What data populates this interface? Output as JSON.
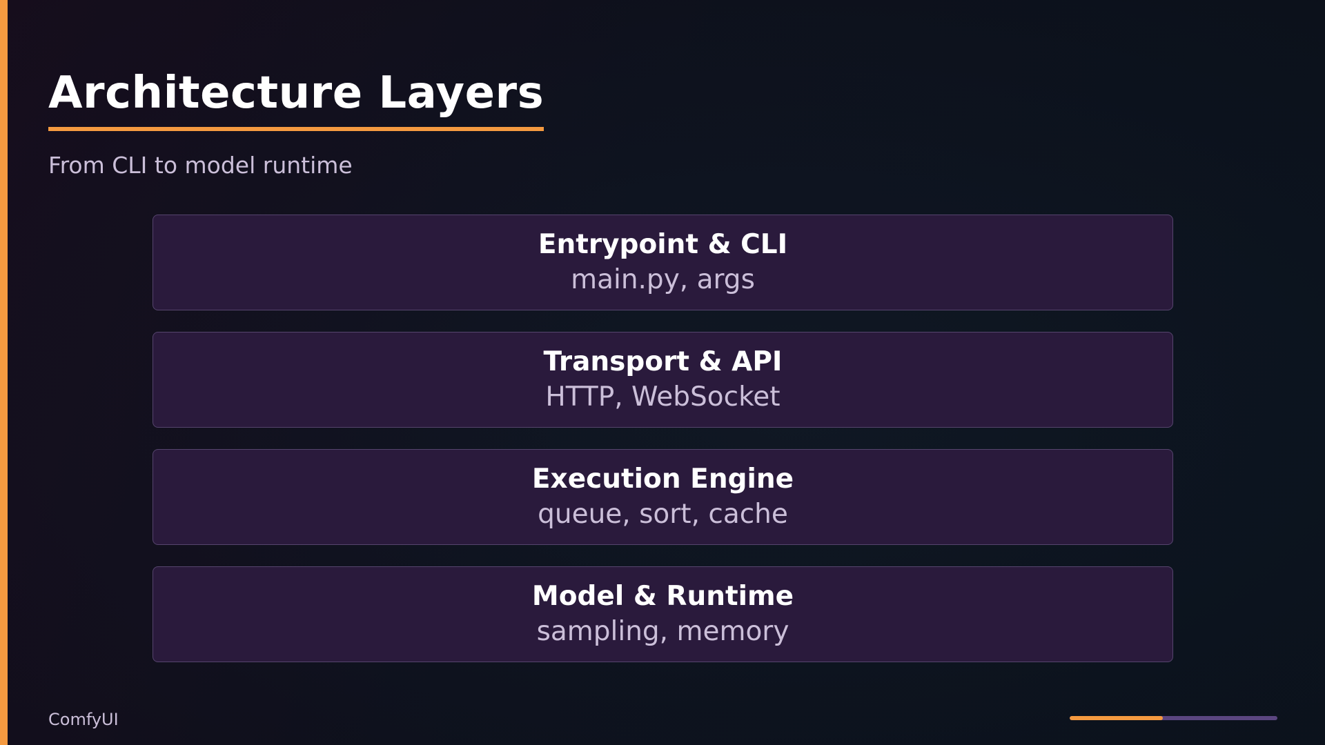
{
  "slide": {
    "title": "Architecture Layers",
    "subtitle": "From CLI to model runtime",
    "brand": "ComfyUI"
  },
  "layers": [
    {
      "title": "Entrypoint & CLI",
      "detail": "main.py, args"
    },
    {
      "title": "Transport & API",
      "detail": "HTTP, WebSocket"
    },
    {
      "title": "Execution Engine",
      "detail": "queue, sort, cache"
    },
    {
      "title": "Model & Runtime",
      "detail": "sampling, memory"
    }
  ],
  "progress": {
    "fraction": 0.45
  },
  "colors": {
    "accent": "#f59a40",
    "layer_fill": "#2a1a3c",
    "layer_border": "#56456e",
    "muted_text": "#cbbfd9",
    "track": "#5b4680"
  }
}
